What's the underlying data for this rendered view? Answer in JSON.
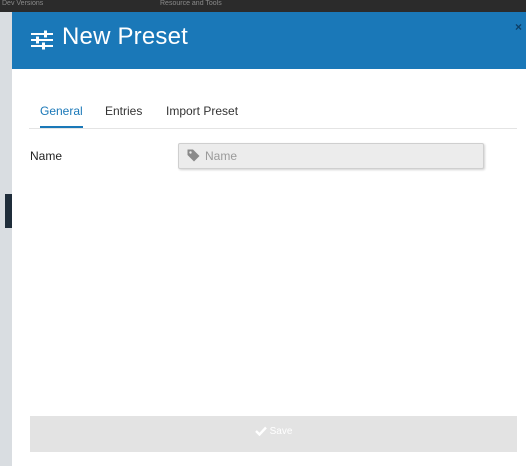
{
  "background": {
    "strip_left_text": "Dev Versions",
    "strip_right_text": "Resource and Tools"
  },
  "modal": {
    "title": "New Preset",
    "title_icon": "sliders-icon",
    "close_label": "×",
    "header_color": "#1a78b8",
    "tabs": [
      {
        "label": "General",
        "active": true
      },
      {
        "label": "Entries",
        "active": false
      },
      {
        "label": "Import Preset",
        "active": false
      }
    ],
    "form": {
      "name_label": "Name",
      "name_placeholder": "Name",
      "name_value": "",
      "name_icon": "tag-icon"
    },
    "save_button": {
      "label": "Save",
      "icon": "checkmark-icon"
    }
  }
}
